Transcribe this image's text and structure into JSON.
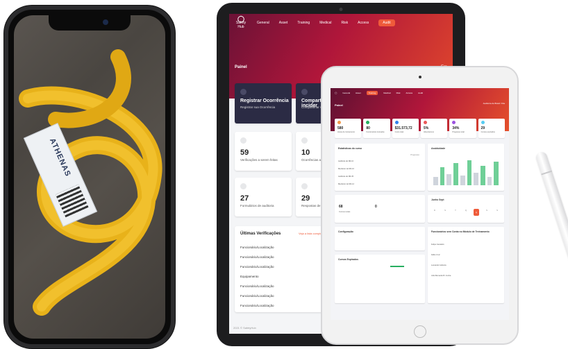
{
  "phone": {
    "tag_brand": "ATHENAS"
  },
  "tablet_back": {
    "logo_name": "Safety Hub",
    "nav": [
      "General",
      "Asset",
      "Training",
      "Medical",
      "Risk",
      "Access",
      "Audit"
    ],
    "page_title": "Painel",
    "page_title_right": "Em",
    "cards": [
      {
        "title": "Registrar Ocorrência",
        "subtitle": "Registrar sua Ocorrência"
      },
      {
        "title": "Compartil de incider",
        "subtitle": "Compartilhar s"
      }
    ],
    "stats": [
      {
        "value": "59",
        "label": "Verificações a serem feitas"
      },
      {
        "value": "10",
        "label": "Ocorrências a o"
      },
      {
        "value": "27",
        "label": "Formulários de auditoria"
      },
      {
        "value": "29",
        "label": "Respostas de f auditoria"
      }
    ],
    "verifications": {
      "title": "Últimas Verificações",
      "link": "Veja a lista completa",
      "items": [
        "Funcionário/Localização",
        "Funcionário/Localização",
        "Funcionário/Localização",
        "Equipamento",
        "Funcionário/Localização",
        "Funcionário/Localização",
        "Funcionário/Localização"
      ]
    },
    "footer": "2021 © SafetyHub"
  },
  "tablet_front": {
    "page_title": "Painel",
    "user": "Auditoria de Brasil / Dia",
    "kpis": [
      {
        "value": "580",
        "label": "Horas de treinamento",
        "color": "#f2994a"
      },
      {
        "value": "80",
        "label": "Funcionários treinados",
        "color": "#27ae60"
      },
      {
        "value": "$31.573,72",
        "label": "Custo total",
        "color": "#2f80ed"
      },
      {
        "value": "5%",
        "label": "Absenteísmo",
        "color": "#eb5757"
      },
      {
        "value": "34%",
        "label": "Progresso total",
        "color": "#9b51e0"
      },
      {
        "value": "29",
        "label": "Cursos expirados",
        "color": "#56ccf2"
      }
    ],
    "stats_title": "Estatísticas do curso",
    "progress_title": "Progresso",
    "attendance_title": "Assiduidade",
    "courses": [
      "Auditoria de NR-10",
      "Mecânico de NR-10",
      "Auditoria de NR-35",
      "Mecânico de NR-12"
    ],
    "week_title": "Junho Sept",
    "days": [
      "D",
      "S",
      "T",
      "Q",
      "Q",
      "S",
      "S"
    ],
    "count_a": "68",
    "count_a_label": "Cursos totais",
    "count_b": "0",
    "config_title": "Configuração",
    "expired_title": "Cursos Expirados",
    "employees_title": "Funcionários sem Conta no Módulo de Treinamento",
    "employees": [
      "Felipe Cavaleiro",
      "Fábio Cruz",
      "Leonardo Cabreira",
      "Júlio Bernardo B. Cunha"
    ]
  }
}
